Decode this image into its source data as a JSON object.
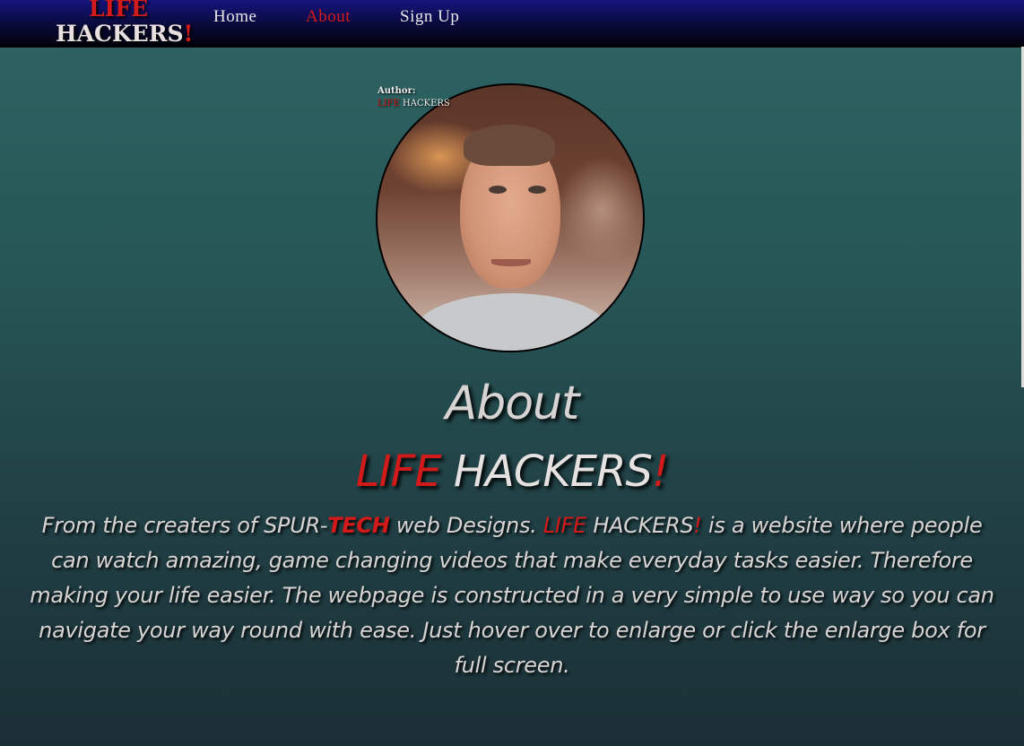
{
  "nav": {
    "logo_line1": "LIFE",
    "logo_line2": "HACKERS",
    "logo_exclaim": "!",
    "links": [
      {
        "label": "Home",
        "active": false
      },
      {
        "label": "About",
        "active": true
      },
      {
        "label": "Sign Up",
        "active": false
      }
    ]
  },
  "profile": {
    "author_label": "Author:",
    "author_brand_red": "LIFE",
    "author_brand_white": " HACKERS"
  },
  "about": {
    "title": "About",
    "brand_red": "LIFE",
    "brand_white": " HACKERS",
    "brand_exclaim": "!",
    "desc_part1": "From the creaters of SPUR-",
    "desc_tech": "TECH",
    "desc_part2": " web Designs. ",
    "desc_life": "LIFE",
    "desc_hackers": " HACKERS",
    "desc_exclaim": "!",
    "desc_part3": " is a website where people can watch amazing, game changing videos that make everyday tasks easier. Therefore making your life easier. The webpage is constructed in a very simple to use way so you can navigate your way round with ease. Just hover over to enlarge or click the enlarge box for full screen."
  },
  "colors": {
    "accent_red": "#d21a1a",
    "nav_top": "#15157e",
    "bg_top": "#2f6464",
    "bg_bottom": "#1a2f35"
  }
}
